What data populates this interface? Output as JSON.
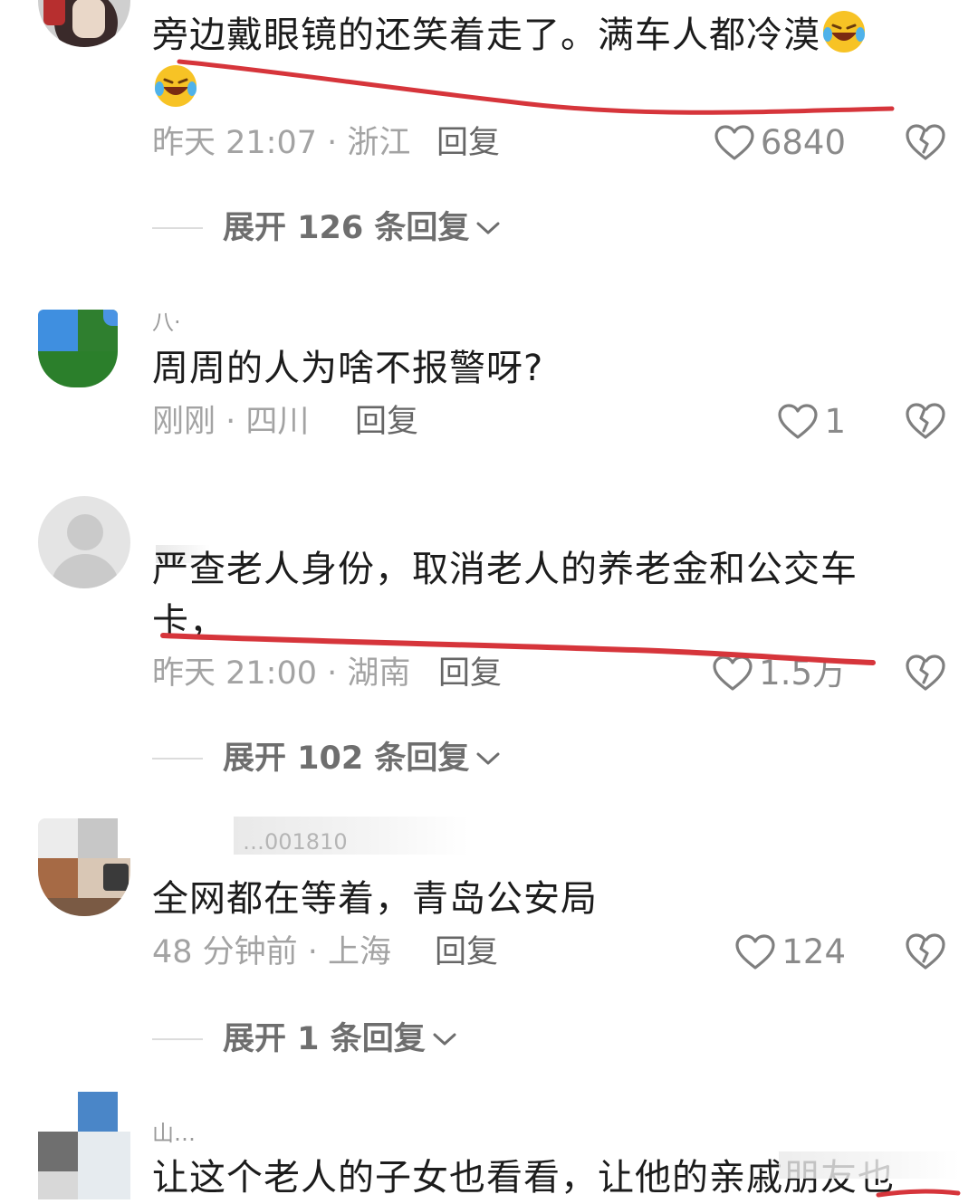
{
  "colors": {
    "annotation": "#d6353b",
    "meta": "#a3a3a3",
    "text": "#1c1c1c"
  },
  "comments": [
    {
      "username": "",
      "text": "旁边戴眼镜的还笑着走了。满车人都冷漠",
      "emoji": "rolling-on-floor-laughing",
      "time_location": "昨天 21:07 · 浙江",
      "reply_label": "回复",
      "likes": "6840",
      "expand_label": "展开 126 条回复"
    },
    {
      "username": "八·",
      "text": "周周的人为啥不报警呀?",
      "time_location": "刚刚 · 四川",
      "reply_label": "回复",
      "likes": "1"
    },
    {
      "username": "",
      "text": "严查老人身份，取消老人的养老金和公交车卡，",
      "time_location": "昨天 21:00 · 湖南",
      "reply_label": "回复",
      "likes": "1.5万",
      "expand_label": "展开 102 条回复"
    },
    {
      "username": "…001810",
      "text": "全网都在等着，青岛公安局",
      "time_location": "48 分钟前 · 上海",
      "reply_label": "回复",
      "likes": "124",
      "expand_label": "展开 1 条回复"
    },
    {
      "username": "山…",
      "text": "让这个老人的子女也看看，让他的亲戚朋友也"
    }
  ]
}
